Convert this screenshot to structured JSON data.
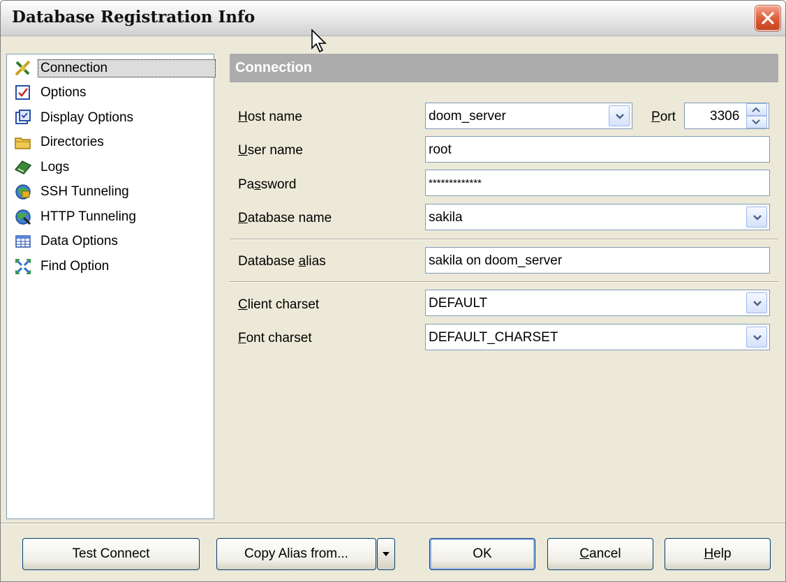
{
  "window": {
    "title": "Database Registration Info"
  },
  "nav": {
    "items": [
      {
        "label": "Connection",
        "icon": "connection-icon",
        "selected": true
      },
      {
        "label": "Options",
        "icon": "options-icon"
      },
      {
        "label": "Display Options",
        "icon": "display-options-icon"
      },
      {
        "label": "Directories",
        "icon": "folder-icon"
      },
      {
        "label": "Logs",
        "icon": "logs-icon"
      },
      {
        "label": "SSH Tunneling",
        "icon": "ssh-tunneling-icon"
      },
      {
        "label": "HTTP Tunneling",
        "icon": "http-tunneling-icon"
      },
      {
        "label": "Data Options",
        "icon": "data-options-icon"
      },
      {
        "label": "Find Option",
        "icon": "find-option-icon"
      }
    ]
  },
  "section": {
    "title": "Connection"
  },
  "form": {
    "host_label_u": "H",
    "host_label_rest": "ost name",
    "host_value": "doom_server",
    "port_label_u": "P",
    "port_label_rest": "ort",
    "port_value": "3306",
    "user_label_u": "U",
    "user_label_rest": "ser name",
    "user_value": "root",
    "password_label_pre": "Pa",
    "password_label_u": "s",
    "password_label_rest": "sword",
    "password_value": "*************",
    "db_label_u": "D",
    "db_label_rest": "atabase name",
    "db_value": "sakila",
    "alias_label_pre": "Database ",
    "alias_label_u": "a",
    "alias_label_rest": "lias",
    "alias_value": "sakila on doom_server",
    "client_label_u": "C",
    "client_label_rest": "lient charset",
    "client_value": "DEFAULT",
    "font_label_u": "F",
    "font_label_rest": "ont charset",
    "font_value": "DEFAULT_CHARSET"
  },
  "buttons": {
    "test_connect": "Test Connect",
    "copy_alias": "Copy Alias from...",
    "ok": "OK",
    "cancel_u": "C",
    "cancel_rest": "ancel",
    "help_u": "H",
    "help_rest": "elp"
  },
  "colors": {
    "accent": "#acacac",
    "close": "#dc5a36",
    "border": "#7f9db9"
  }
}
